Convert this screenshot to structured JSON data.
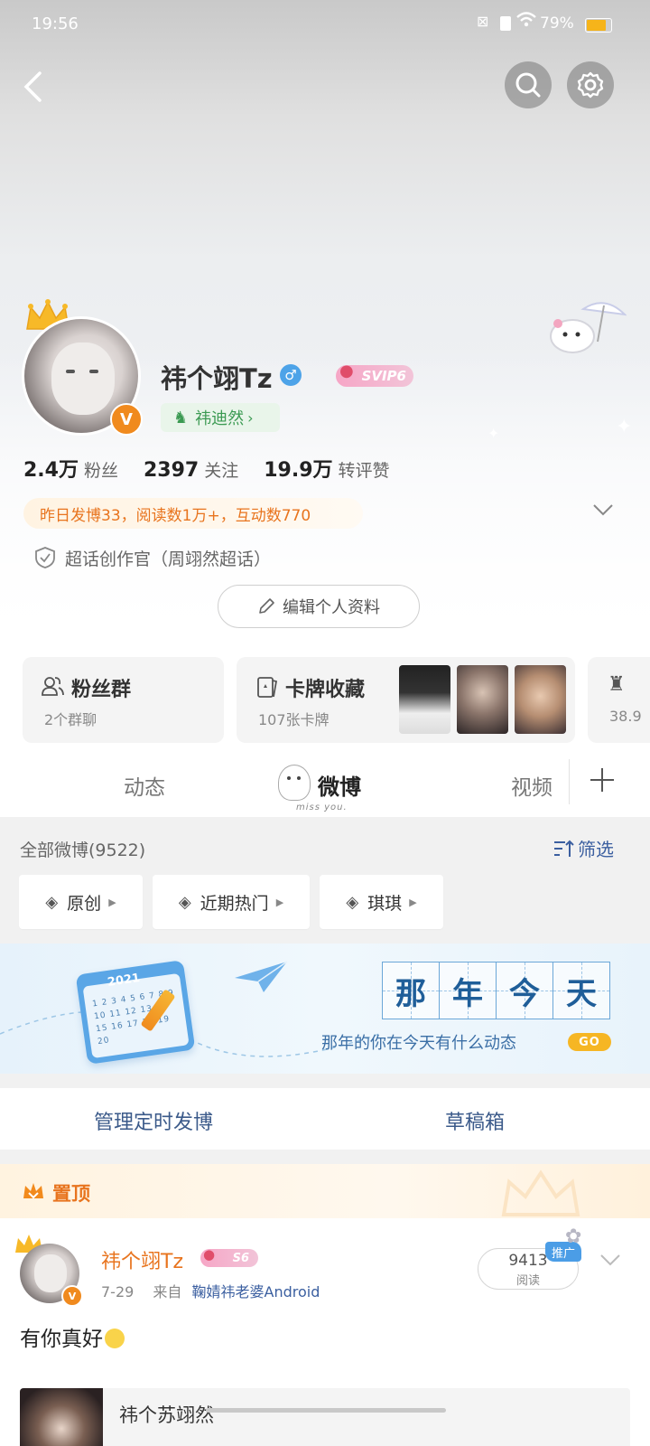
{
  "status_bar": {
    "time": "19:56",
    "battery": "79%"
  },
  "profile": {
    "name": "祎个翊Tz",
    "vip_badge": "SVIP6",
    "group_tag": "祎迪然",
    "stats": [
      {
        "num": "2.4万",
        "label": "粉丝"
      },
      {
        "num": "2397",
        "label": "关注"
      },
      {
        "num": "19.9万",
        "label": "转评赞"
      }
    ],
    "summary": "昨日发博33，阅读数1万+，互动数770",
    "supertopic": "超话创作官（周翊然超话）",
    "edit_button": "编辑个人资料"
  },
  "feature_cards": [
    {
      "title": "粉丝群",
      "sub": "2个群聊"
    },
    {
      "title": "卡牌收藏",
      "sub": "107张卡牌"
    },
    {
      "title": "",
      "sub": "38.9"
    }
  ],
  "tabs": {
    "items": [
      "动态",
      "微博",
      "视频"
    ],
    "active_deco": "miss you."
  },
  "feed": {
    "all_posts": "全部微博(9522)",
    "filter": "筛选",
    "filters": [
      "原创",
      "近期热门",
      "琪琪"
    ]
  },
  "banner": {
    "title_chars": [
      "那",
      "年",
      "今",
      "天"
    ],
    "subtitle": "那年的你在今天有什么动态",
    "go": "GO",
    "calendar_year": "2021",
    "calendar_nums": "1 2 3 4 5 6 7 8 9 10 11 12 13 14 15 16 17 18 19 20"
  },
  "actions": {
    "scheduled": "管理定时发博",
    "drafts": "草稿箱"
  },
  "pinned": {
    "label": "置顶",
    "user": "祎个翊Tz",
    "badge": "S6",
    "date": "7-29",
    "from_prefix": "来自",
    "source": "鞠婧祎老婆Android",
    "views_num": "9413",
    "views_label": "阅读",
    "promo": "推广",
    "content": "有你真好"
  },
  "bottom_preview": {
    "text": "祎个苏翊然"
  },
  "colors": {
    "accent_orange": "#e8741e",
    "link_blue": "#3b5fa0",
    "vip_pink": "#f08cb3"
  }
}
